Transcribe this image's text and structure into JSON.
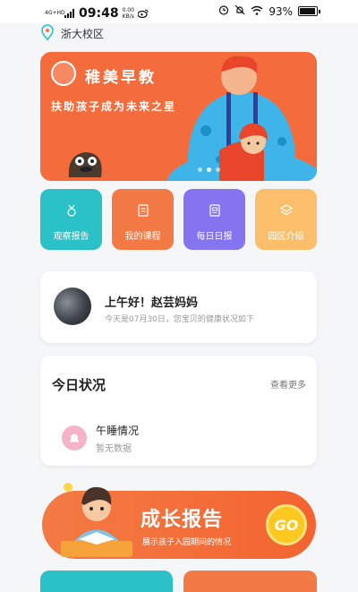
{
  "status_bar": {
    "network": "4G+HD",
    "time": "09:48",
    "speed_value": "0.00",
    "speed_unit": "KB/s",
    "battery": "93%",
    "battery_level": 0.93
  },
  "location": {
    "name": "浙大校区",
    "icon": "location-pin-icon"
  },
  "banner": {
    "title": "稚美早教",
    "subtitle": "扶助孩子成为未来之星",
    "slide_count": 3,
    "active_slide": 1
  },
  "tiles": [
    {
      "label": "观察报告",
      "icon": "medal-icon",
      "color": "#2bc1c8"
    },
    {
      "label": "我的课程",
      "icon": "book-icon",
      "color": "#f47a45"
    },
    {
      "label": "每日日报",
      "icon": "document-icon",
      "color": "#8574f0"
    },
    {
      "label": "园区介绍",
      "icon": "layers-icon",
      "color": "#fbbf6b"
    }
  ],
  "greeting": {
    "title": "上午好！赵芸妈妈",
    "subtitle": "今天是07月30日，您宝贝的健康状况如下"
  },
  "today_status": {
    "title": "今日状况",
    "more": "查看更多",
    "items": [
      {
        "title": "午睡情况",
        "status": "暂无数据",
        "icon": "bell-icon"
      }
    ]
  },
  "growth_report": {
    "title": "成长报告",
    "subtitle": "展示孩子入园期间的情况",
    "button": "GO"
  }
}
